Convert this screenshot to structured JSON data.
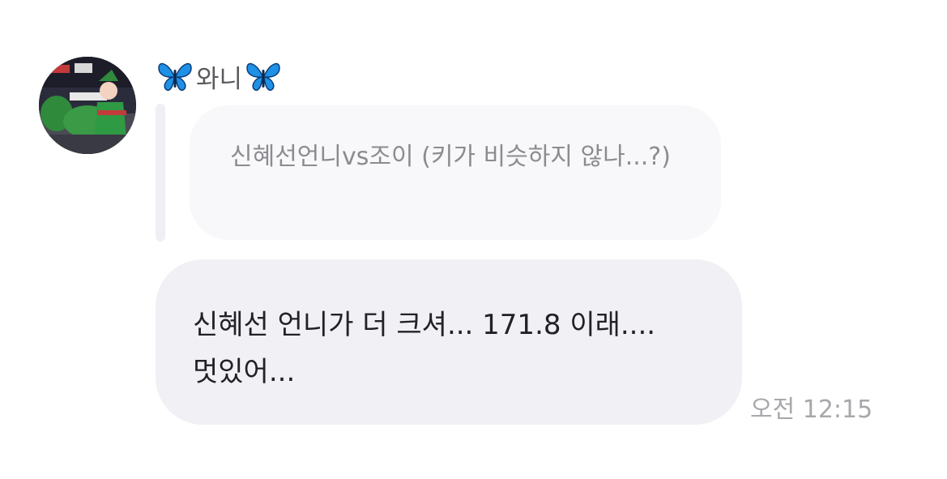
{
  "sender": {
    "name": "와니",
    "emoji_icon": "blue-butterfly-icon",
    "emoji_color": "#1e90e6"
  },
  "quoted_message": {
    "text": "신혜선언니vs조이 (키가 비슷하지 않나...?)"
  },
  "message": {
    "text": "신혜선 언니가 더 크셔... 171.8 이래.... 멋있어...",
    "time": "오전 12:15"
  },
  "colors": {
    "quote_bubble": "#f8f8fa",
    "reply_bubble": "#f1f1f5",
    "quote_bar": "#efeff4",
    "time_text": "#a7a7ac"
  }
}
